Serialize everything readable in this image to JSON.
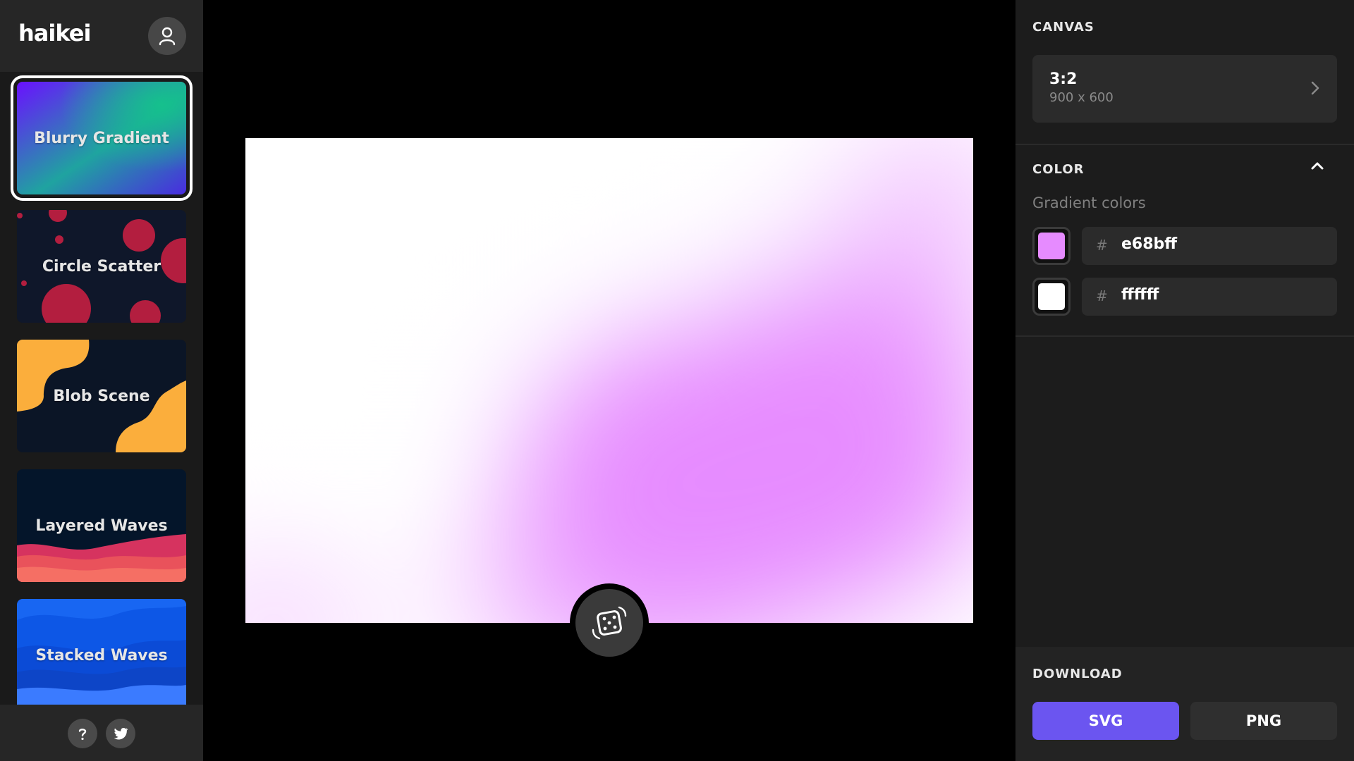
{
  "app": {
    "logo": "haikei"
  },
  "sidebar": {
    "generators": [
      {
        "label": "Blurry Gradient",
        "active": true
      },
      {
        "label": "Circle Scatter",
        "active": false
      },
      {
        "label": "Blob Scene",
        "active": false
      },
      {
        "label": "Layered Waves",
        "active": false
      },
      {
        "label": "Stacked Waves",
        "active": false
      }
    ],
    "footer": {
      "help_icon": "question-icon",
      "twitter_icon": "twitter-icon"
    }
  },
  "stage": {
    "randomize_icon": "dice-icon"
  },
  "panel": {
    "canvas": {
      "title": "CANVAS",
      "ratio": "3:2",
      "dimensions": "900 x 600"
    },
    "color": {
      "title": "COLOR",
      "gradient_label": "Gradient colors",
      "hash": "#",
      "colors": [
        {
          "hex": "e68bff",
          "swatch": "#e68bff"
        },
        {
          "hex": "ffffff",
          "swatch": "#ffffff"
        }
      ]
    },
    "download": {
      "title": "DOWNLOAD",
      "svg_label": "SVG",
      "png_label": "PNG"
    }
  },
  "colors": {
    "accent": "#6b55f0",
    "gradient_primary": "#e68bff",
    "gradient_secondary": "#ffffff"
  }
}
